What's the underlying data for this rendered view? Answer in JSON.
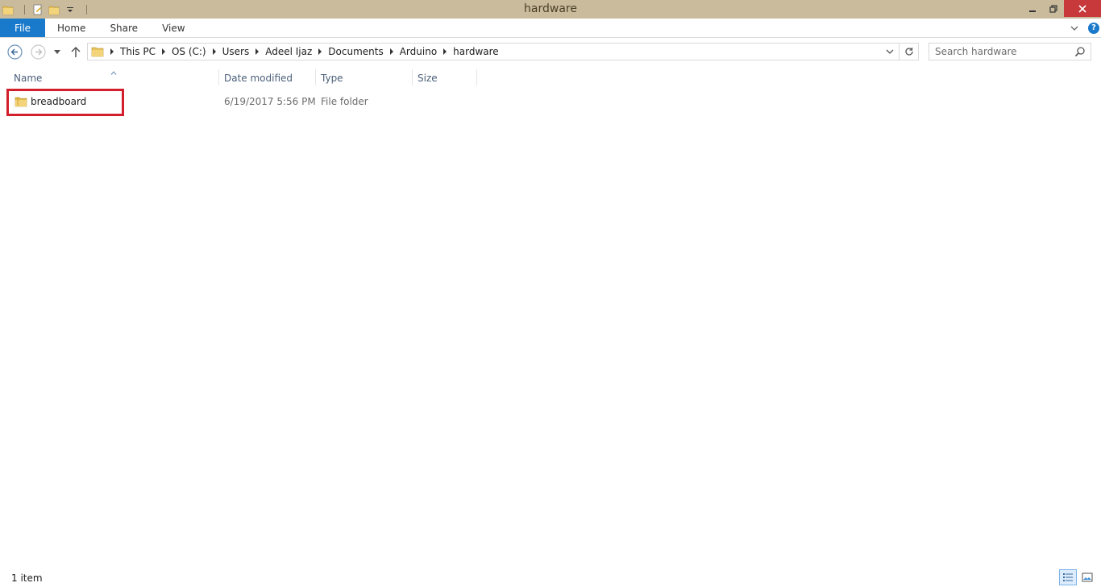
{
  "window": {
    "title": "hardware"
  },
  "ribbon": {
    "tabs": [
      {
        "label": "File"
      },
      {
        "label": "Home"
      },
      {
        "label": "Share"
      },
      {
        "label": "View"
      }
    ],
    "help_label": "?"
  },
  "address": {
    "crumbs": [
      "This PC",
      "OS (C:)",
      "Users",
      "Adeel Ijaz",
      "Documents",
      "Arduino",
      "hardware"
    ]
  },
  "search": {
    "placeholder": "Search hardware"
  },
  "columns": {
    "name": "Name",
    "date": "Date modified",
    "type": "Type",
    "size": "Size"
  },
  "files": [
    {
      "name": "breadboard",
      "date": "6/19/2017 5:56 PM",
      "type": "File folder",
      "size": ""
    }
  ],
  "status": {
    "item_count": "1 item"
  },
  "colors": {
    "accent": "#1979ca",
    "titlebar": "#c9bb9b",
    "close": "#c7393a",
    "highlight": "#d21f2b"
  }
}
